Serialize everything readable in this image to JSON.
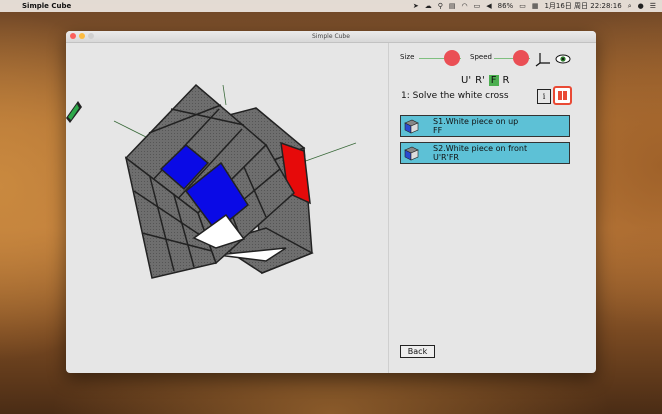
{
  "menubar": {
    "apple": "",
    "app_name": "Simple Cube",
    "battery": "86%",
    "datetime": "1月16日 周日  22:28:16"
  },
  "window": {
    "title": "Simple Cube"
  },
  "controls": {
    "size_label": "Size",
    "speed_label": "Speed"
  },
  "moves": [
    "U'",
    "R'",
    "F",
    "R"
  ],
  "current_move_index": 2,
  "step": {
    "title": "1: Solve the white cross",
    "info_label": "i"
  },
  "hints": [
    {
      "line1": "S1.White piece on up",
      "line2": "FF"
    },
    {
      "line1": "S2.White piece on front",
      "line2": "U'R'FR"
    }
  ],
  "back_label": "Back",
  "colors": {
    "accent_red": "#ea4f55",
    "hint_bg": "#5dc1d6",
    "cube_blue": "#0a0ae6",
    "cube_red": "#e60a0a",
    "cube_white": "#ffffff",
    "cube_gray": "#6e6e6e"
  }
}
